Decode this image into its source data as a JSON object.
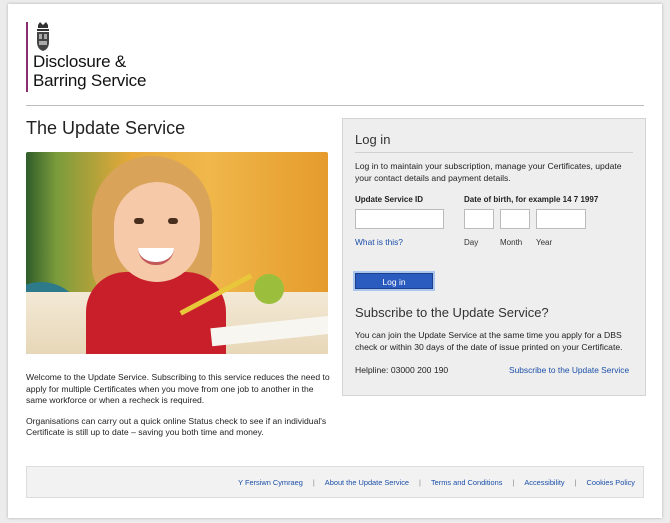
{
  "header": {
    "brand_line1": "Disclosure &",
    "brand_line2": "Barring Service",
    "crest_icon": "royal-crest-icon",
    "accent_color": "#8a2d6e"
  },
  "main": {
    "title": "The Update Service",
    "intro_p1": "Welcome to the Update Service. Subscribing to this service reduces the need to apply for multiple Certificates when you move from one job to another in the same workforce or when a recheck is required.",
    "intro_p2": "Organisations can carry out a quick online Status check to see if an individual's Certificate is still up to date – saving you both time and money."
  },
  "login": {
    "heading": "Log in",
    "description": "Log in to maintain your subscription, manage your Certificates, update your contact details and payment details.",
    "update_id_label": "Update Service ID",
    "dob_label": "Date of birth, for example 14 7 1997",
    "update_id_value": "",
    "dob_day_value": "",
    "dob_month_value": "",
    "dob_year_value": "",
    "day_label": "Day",
    "month_label": "Month",
    "year_label": "Year",
    "what_is_this": "What is this?",
    "button_label": "Log in",
    "button_color": "#2a5bbf"
  },
  "subscribe": {
    "heading": "Subscribe to the Update Service?",
    "description": "You can join the Update Service at the same time you apply for a DBS check or within 30 days of the date of issue printed on your Certificate.",
    "helpline": "Helpline: 03000 200 190",
    "link": "Subscribe to the Update Service"
  },
  "footer": {
    "links": [
      "Y Fersiwn Cymraeg",
      "About the Update Service",
      "Terms and Conditions",
      "Accessibility",
      "Cookies Policy"
    ],
    "link_color": "#1b4fa8"
  }
}
